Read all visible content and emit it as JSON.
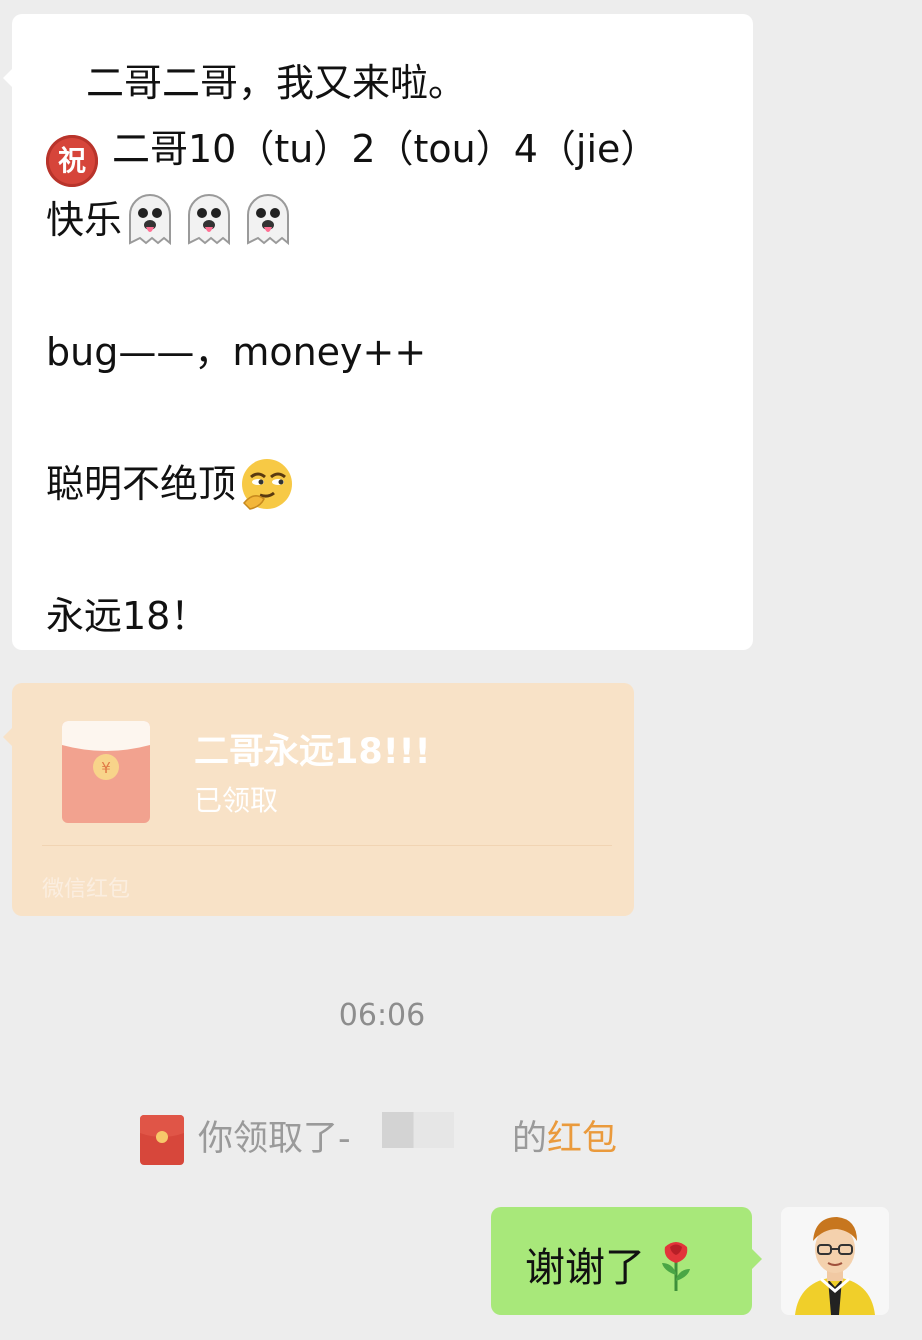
{
  "incoming_message": {
    "line1": "二哥二哥，我又来啦。",
    "zhu_badge": "祝",
    "line2": "二哥10（tu）2（tou）4（jie）",
    "line3": "快乐",
    "line4": "bug——，money++",
    "line5": "聪明不绝顶",
    "line6": "永远18！",
    "icons": [
      "zhu-badge-icon",
      "ghost-icon",
      "ghost-icon",
      "ghost-icon",
      "smirk-face-icon"
    ]
  },
  "red_packet": {
    "title": "二哥永远18!!!",
    "status": "已领取",
    "brand": "微信红包",
    "envelope_symbol": "¥",
    "colors": {
      "background": "#f8e2c7",
      "envelope": "#f2a28f"
    }
  },
  "timestamp": "06:06",
  "system_notice": {
    "text_before": "你领取了-",
    "text_after": "的",
    "link_text": "红包",
    "colors": {
      "link": "#ea9a3c"
    }
  },
  "outgoing_message": {
    "text": "谢谢了",
    "icon": "rose-icon",
    "colors": {
      "bubble": "#a8e87a"
    }
  },
  "avatar": {
    "icon": "cartoon-person-avatar"
  }
}
